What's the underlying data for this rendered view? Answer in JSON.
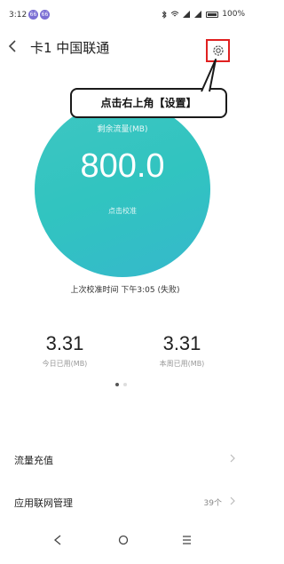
{
  "status_bar": {
    "time": "3:12",
    "badges": [
      "66",
      "66"
    ],
    "battery": "100%"
  },
  "header": {
    "title": "卡1 中国联通",
    "back_icon": "chevron-left-icon",
    "settings_icon": "gear-icon"
  },
  "callout": {
    "text": "点击右上角【设置】"
  },
  "gauge": {
    "label": "剩余流量(MB)",
    "value": "800.0",
    "link": "点击校准",
    "color": "#31c4c0"
  },
  "calibration": {
    "text": "上次校准时间 下午3:05 (失败)"
  },
  "stats": [
    {
      "value": "3.31",
      "label": "今日已用(MB)"
    },
    {
      "value": "3.31",
      "label": "本周已用(MB)"
    }
  ],
  "pager": {
    "count": 2,
    "active": 0
  },
  "list": [
    {
      "label": "流量充值",
      "count": ""
    },
    {
      "label": "应用联网管理",
      "count": "39个"
    }
  ],
  "nav": {
    "back_icon": "triangle-back-icon",
    "home_icon": "circle-home-icon",
    "menu_icon": "menu-lines-icon"
  }
}
